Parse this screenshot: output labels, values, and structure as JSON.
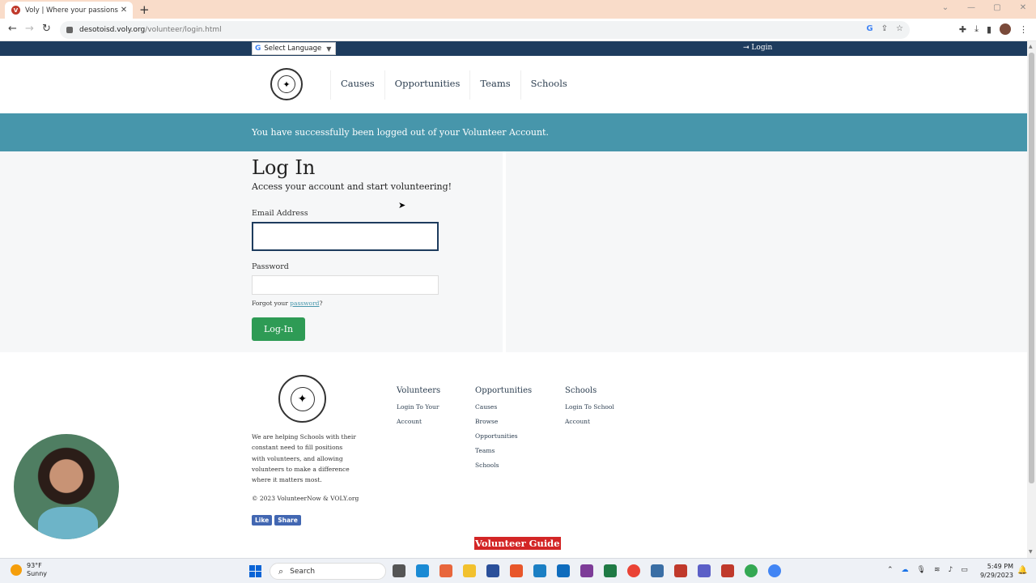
{
  "browser": {
    "tab_title": "Voly | Where your passions and",
    "favicon_letter": "V",
    "url_host": "desotoisd.voly.org",
    "url_path": "/volunteer/login.html"
  },
  "topbar": {
    "lang_label": "Select Language",
    "login_label": "Login"
  },
  "nav": {
    "items": [
      "Causes",
      "Opportunities",
      "Teams",
      "Schools"
    ]
  },
  "alert": {
    "message": "You have successfully been logged out of your Volunteer Account."
  },
  "login": {
    "title": "Log In",
    "subtitle": "Access your account and start volunteering!",
    "email_label": "Email Address",
    "email_value": "",
    "password_label": "Password",
    "password_value": "",
    "forgot_prefix": "Forgot your ",
    "forgot_link": "password",
    "forgot_suffix": "?",
    "button": "Log-In"
  },
  "footer": {
    "description": "We are helping Schools with their constant need to fill positions with volunteers, and allowing volunteers to make a difference where it matters most.",
    "copyright": "© 2023 VolunteerNow & VOLY.org",
    "like": "Like",
    "share": "Share",
    "columns": {
      "volunteers": {
        "title": "Volunteers",
        "links": [
          "Login To Your",
          "Account"
        ]
      },
      "opportunities": {
        "title": "Opportunities",
        "links": [
          "Causes",
          "Browse",
          "Opportunities",
          "Teams",
          "Schools"
        ]
      },
      "schools": {
        "title": "Schools",
        "links": [
          "Login To School",
          "Account"
        ]
      }
    },
    "guide": "Volunteer Guide"
  },
  "taskbar": {
    "temp": "93°F",
    "condition": "Sunny",
    "search": "Search",
    "time": "5:49 PM",
    "date": "9/29/2023"
  },
  "colors": {
    "navy": "#1e3c5e",
    "alert_teal": "#4796ab",
    "button_green": "#2e9b55",
    "guide_red": "#d32626"
  }
}
